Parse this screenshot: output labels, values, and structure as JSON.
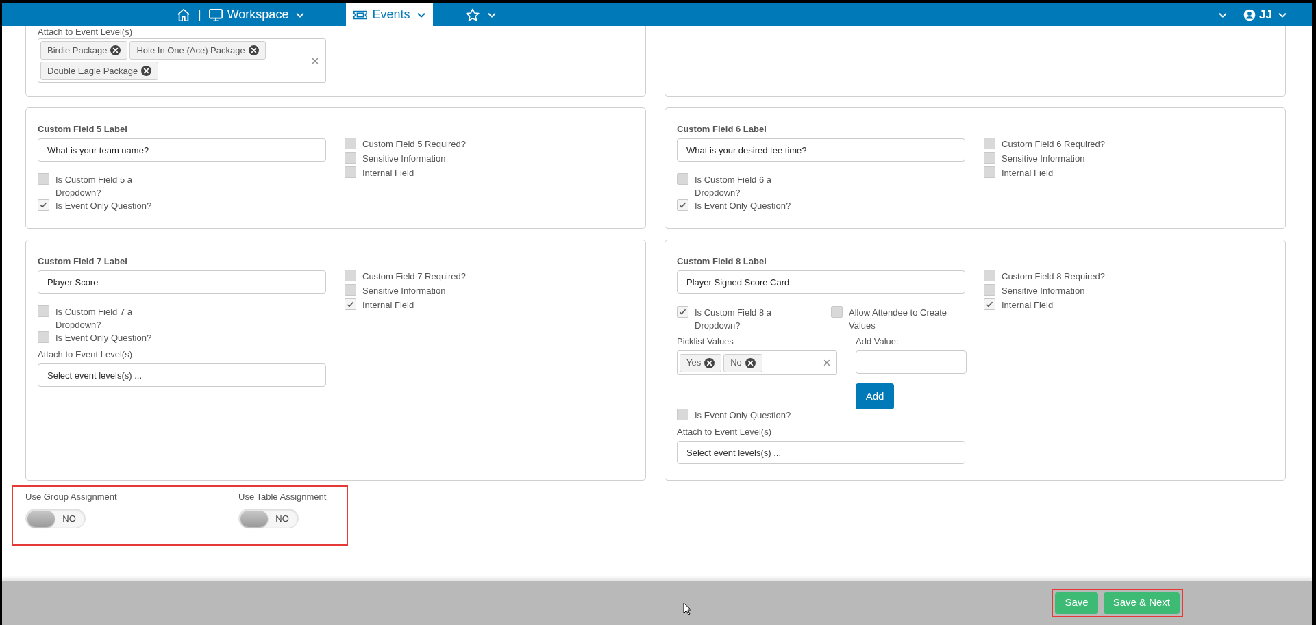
{
  "nav": {
    "separator": "|",
    "tabs": [
      {
        "kind": "workspace",
        "label": "Workspace",
        "selected": false
      },
      {
        "kind": "events",
        "label": "Events",
        "selected": true
      },
      {
        "kind": "favorites",
        "selected": false
      }
    ],
    "user": {
      "initials": "JJ"
    }
  },
  "top_card": {
    "attach_label": "Attach to Event Level(s)",
    "tags": [
      "Birdie Package",
      "Hole In One (Ace) Package",
      "Double Eagle Package"
    ]
  },
  "custom_fields": [
    {
      "title": "Custom Field 5 Label",
      "value": "What is your team name?",
      "dropdown": {
        "label": "Is Custom Field 5 a Dropdown?",
        "checked": false
      },
      "event_only": {
        "label": "Is Event Only Question?",
        "checked": true
      },
      "side_checks": [
        {
          "label": "Custom Field 5 Required?",
          "checked": false
        },
        {
          "label": "Sensitive Information",
          "checked": false
        },
        {
          "label": "Internal Field",
          "checked": false
        }
      ]
    },
    {
      "title": "Custom Field 6 Label",
      "value": "What is your desired tee time?",
      "dropdown": {
        "label": "Is Custom Field 6 a Dropdown?",
        "checked": false
      },
      "event_only": {
        "label": "Is Event Only Question?",
        "checked": true
      },
      "side_checks": [
        {
          "label": "Custom Field 6 Required?",
          "checked": false
        },
        {
          "label": "Sensitive Information",
          "checked": false
        },
        {
          "label": "Internal Field",
          "checked": false
        }
      ]
    },
    {
      "title": "Custom Field 7 Label",
      "value": "Player Score",
      "dropdown": {
        "label": "Is Custom Field 7 a Dropdown?",
        "checked": false
      },
      "event_only": {
        "label": "Is Event Only Question?",
        "checked": false
      },
      "attach": {
        "label": "Attach to Event Level(s)",
        "placeholder": "Select event levels(s) ..."
      },
      "side_checks": [
        {
          "label": "Custom Field 7 Required?",
          "checked": false
        },
        {
          "label": "Sensitive Information",
          "checked": false
        },
        {
          "label": "Internal Field",
          "checked": true
        }
      ]
    },
    {
      "title": "Custom Field 8 Label",
      "value": "Player Signed Score Card",
      "dropdown": {
        "label": "Is Custom Field 8 a Dropdown?",
        "checked": true
      },
      "allow_create": {
        "label": "Allow Attendee to Create Values",
        "checked": false
      },
      "picklist": {
        "label": "Picklist Values",
        "values": [
          "Yes",
          "No"
        ],
        "add_label": "Add Value:",
        "add_button": "Add"
      },
      "event_only": {
        "label": "Is Event Only Question?",
        "checked": false
      },
      "attach": {
        "label": "Attach to Event Level(s)",
        "placeholder": "Select event levels(s) ..."
      },
      "side_checks": [
        {
          "label": "Custom Field 8 Required?",
          "checked": false
        },
        {
          "label": "Sensitive Information",
          "checked": false
        },
        {
          "label": "Internal Field",
          "checked": true
        }
      ]
    }
  ],
  "toggles": [
    {
      "label": "Use Group Assignment",
      "on": false,
      "state_text": "NO"
    },
    {
      "label": "Use Table Assignment",
      "on": false,
      "state_text": "NO"
    }
  ],
  "footer_buttons": [
    "Save",
    "Save & Next"
  ]
}
